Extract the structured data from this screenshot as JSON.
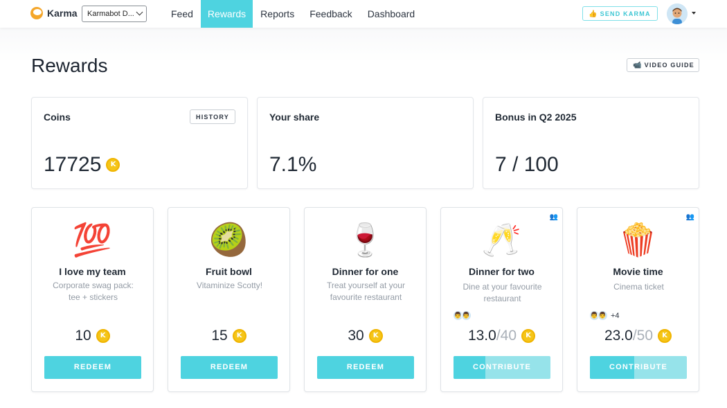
{
  "app": {
    "name": "Karma"
  },
  "nav": {
    "team_select": "Karmabot D...",
    "items": [
      {
        "label": "Feed",
        "active": false
      },
      {
        "label": "Rewards",
        "active": true
      },
      {
        "label": "Reports",
        "active": false
      },
      {
        "label": "Feedback",
        "active": false
      },
      {
        "label": "Dashboard",
        "active": false
      }
    ],
    "send_karma_label": "SEND KARMA",
    "send_karma_icon": "👍"
  },
  "page": {
    "title": "Rewards",
    "video_guide_label": "VIDEO GUIDE",
    "video_guide_icon": "📹"
  },
  "stats": {
    "coins": {
      "label": "Coins",
      "value": "17725",
      "history_label": "HISTORY"
    },
    "share": {
      "label": "Your share",
      "value": "7.1%"
    },
    "bonus": {
      "label": "Bonus in Q2 2025",
      "value": "7 / 100"
    }
  },
  "coin_symbol": "K",
  "rewards": [
    {
      "emoji": "💯",
      "title": "I love my team",
      "description": "Corporate swag pack: tee + stickers",
      "price": "10",
      "button": "REDEEM",
      "group": false
    },
    {
      "emoji": "🥝",
      "title": "Fruit bowl",
      "description": "Vitaminize Scotty!",
      "price": "15",
      "button": "REDEEM",
      "group": false
    },
    {
      "emoji": "🍷",
      "title": "Dinner for one",
      "description": "Treat yourself at your favourite restaurant",
      "price": "30",
      "button": "REDEEM",
      "group": false
    },
    {
      "emoji": "🥂",
      "title": "Dinner for two",
      "description": "Dine at your favourite restaurant",
      "collected": "13.0",
      "target": "/40",
      "progress": 0.325,
      "button": "CONTRIBUTE",
      "group": true,
      "group_icon": "👥",
      "contributor_avatar": "👨",
      "extra_contributors": ""
    },
    {
      "emoji": "🍿",
      "title": "Movie time",
      "description": "Cinema ticket",
      "collected": "23.0",
      "target": "/50",
      "progress": 0.46,
      "button": "CONTRIBUTE",
      "group": true,
      "group_icon": "👥",
      "contributor_avatar": "👨",
      "extra_contributors": "+4"
    }
  ]
}
